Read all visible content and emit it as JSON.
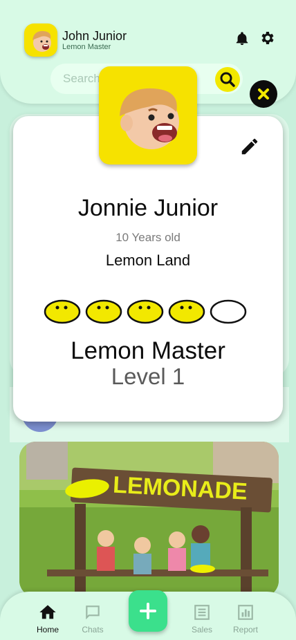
{
  "header": {
    "user_name": "John Junior",
    "user_role": "Lemon Master",
    "search_placeholder": "Search"
  },
  "profile_modal": {
    "name": "Jonnie Junior",
    "age": "10 Years old",
    "location": "Lemon Land",
    "rank_title": "Lemon Master",
    "level": "Level 1",
    "lemon_rating": {
      "filled": 4,
      "total": 5
    }
  },
  "feed": {
    "photo_sign_text": "LEMONADE"
  },
  "bottom_nav": {
    "items": [
      {
        "label": "Home",
        "icon": "home-icon",
        "active": true
      },
      {
        "label": "Chats",
        "icon": "chat-icon",
        "active": false
      },
      {
        "label": "Sales",
        "icon": "sales-icon",
        "active": false
      },
      {
        "label": "Report",
        "icon": "report-icon",
        "active": false
      }
    ],
    "fab_icon": "plus-icon"
  },
  "colors": {
    "background": "#c8f0dc",
    "panel": "#d8fae6",
    "lemon_yellow": "#f6e200",
    "fab_green": "#3be08c"
  }
}
